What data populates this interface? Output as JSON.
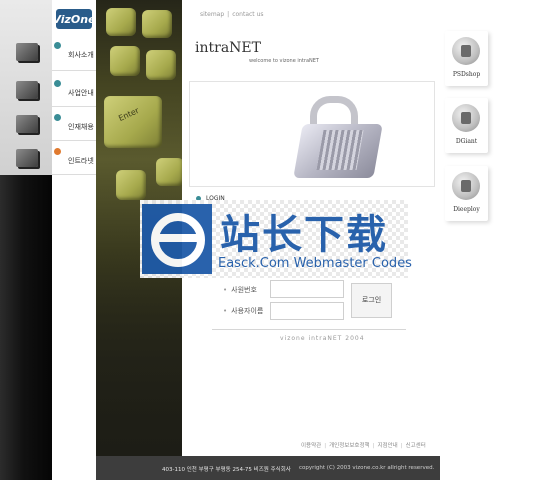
{
  "brand": {
    "logo_text": "VizOne"
  },
  "nav": {
    "items": [
      {
        "label": "회사소개",
        "icon": "building-icon",
        "accent": "#3a8d96"
      },
      {
        "label": "사업안내",
        "icon": "server-icon",
        "accent": "#3a8d96"
      },
      {
        "label": "인재채용",
        "icon": "computer-icon",
        "accent": "#3a8d96"
      },
      {
        "label": "인트라넷",
        "icon": "gear-icon",
        "accent": "#e07a2f"
      }
    ]
  },
  "keyboard": {
    "enter_label": "Enter"
  },
  "header": {
    "links": [
      "sitemap",
      "contact us"
    ]
  },
  "main": {
    "title": "intraNET",
    "subtitle": "welcome to vizone intraNET"
  },
  "login": {
    "heading": "LOGIN",
    "id_label": "사원번호",
    "pw_label": "사용자이름",
    "button": "로그인",
    "footer_text": "vizone intraNET 2004"
  },
  "watermark": {
    "cn": "站长下载",
    "en": "Easck.Com Webmaster Codes"
  },
  "bottom_links": [
    "이용약관",
    "개인정보보호정책",
    "지점안내",
    "신고센터"
  ],
  "products": [
    {
      "label": "PSDshop"
    },
    {
      "label": "DGiant"
    },
    {
      "label": "Dieeploy"
    }
  ],
  "footer": {
    "address": "403-110 인천 부평구 부평동 254-75 비즈원 주식회사",
    "copyright": "copyright (C) 2003 vizone.co.kr allright reserved."
  },
  "colors": {
    "accent": "#3a8d96",
    "accent_active": "#e07a2f",
    "watermark_blue": "#1e5aa8",
    "footer_bg": "#3d3d3d"
  }
}
